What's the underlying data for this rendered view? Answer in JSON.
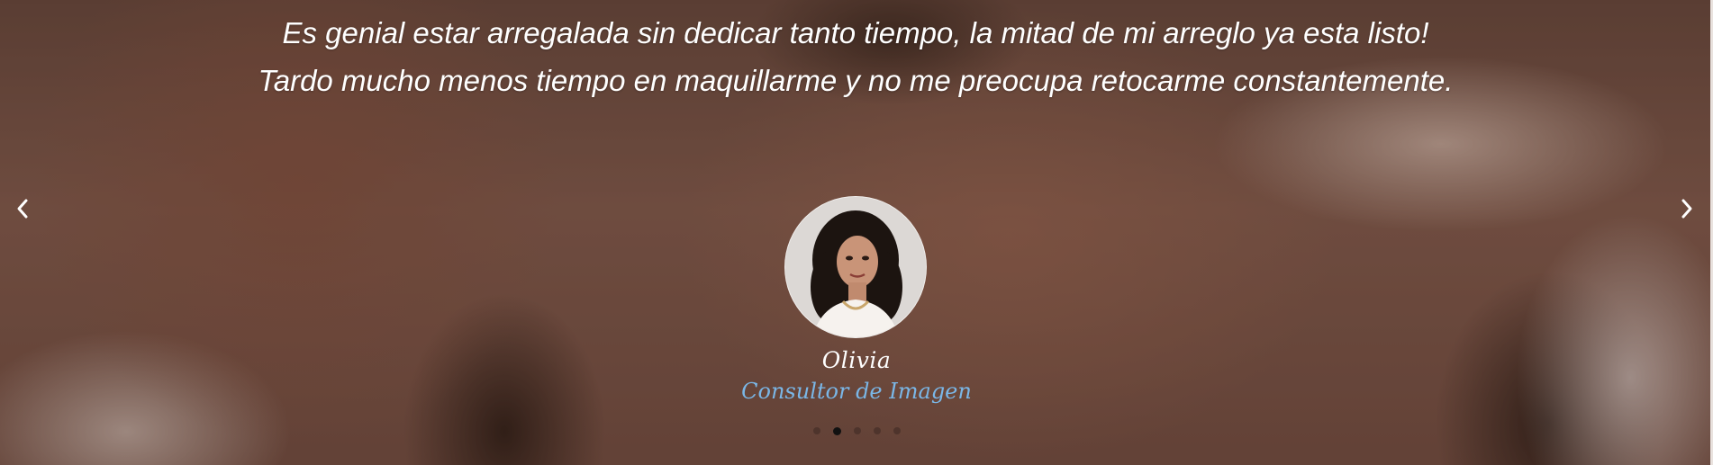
{
  "testimonial": {
    "quote": "Es genial estar arregalada sin dedicar tanto tiempo, la mitad de mi arreglo ya esta listo! Tardo mucho menos tiempo en maquillarme y no me preocupa retocarme constantemente.",
    "name": "Olivia",
    "role": "Consultor de Imagen"
  },
  "carousel": {
    "slide_count": 5,
    "active_index": 1,
    "prev_icon": "chevron-left-icon",
    "next_icon": "chevron-right-icon"
  },
  "colors": {
    "quote_text": "#ffffff",
    "role_text": "#7ab6e6",
    "dot_active": "#111111"
  }
}
